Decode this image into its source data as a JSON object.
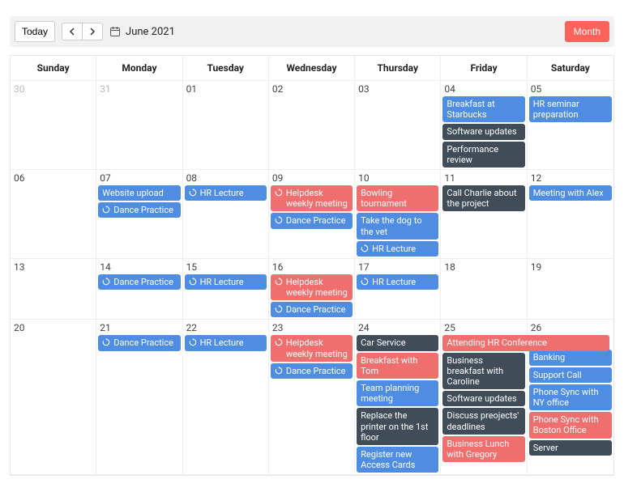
{
  "toolbar": {
    "today_label": "Today",
    "title": "June 2021",
    "view_label": "Month"
  },
  "daysOfWeek": [
    "Sunday",
    "Monday",
    "Tuesday",
    "Wednesday",
    "Thursday",
    "Friday",
    "Saturday"
  ],
  "weeks": [
    {
      "days": [
        {
          "date": "30",
          "out": true,
          "events": []
        },
        {
          "date": "31",
          "out": true,
          "events": []
        },
        {
          "date": "01",
          "events": []
        },
        {
          "date": "02",
          "events": []
        },
        {
          "date": "03",
          "events": []
        },
        {
          "date": "04",
          "events": [
            {
              "text": "Breakfast at Starbucks",
              "color": "blue"
            },
            {
              "text": "Software updates",
              "color": "dark"
            },
            {
              "text": "Performance review",
              "color": "dark"
            }
          ]
        },
        {
          "date": "05",
          "events": [
            {
              "text": "HR seminar preparation",
              "color": "blue"
            }
          ]
        }
      ]
    },
    {
      "days": [
        {
          "date": "06",
          "events": []
        },
        {
          "date": "07",
          "events": [
            {
              "text": "Website upload",
              "color": "blue"
            },
            {
              "text": "Dance Practice",
              "color": "blue",
              "recurring": true
            }
          ]
        },
        {
          "date": "08",
          "events": [
            {
              "text": "HR Lecture",
              "color": "blue",
              "recurring": true
            }
          ]
        },
        {
          "date": "09",
          "events": [
            {
              "text": "Helpdesk weekly meeting",
              "color": "red",
              "recurring": true
            },
            {
              "text": "Dance Practice",
              "color": "blue",
              "recurring": true
            }
          ]
        },
        {
          "date": "10",
          "events": [
            {
              "text": "Bowling tournament",
              "color": "red"
            },
            {
              "text": "Take the dog to the vet",
              "color": "blue"
            },
            {
              "text": "HR Lecture",
              "color": "blue",
              "recurring": true
            }
          ]
        },
        {
          "date": "11",
          "events": [
            {
              "text": "Call Charlie about the project",
              "color": "dark"
            }
          ]
        },
        {
          "date": "12",
          "events": [
            {
              "text": "Meeting with Alex",
              "color": "blue"
            }
          ]
        }
      ]
    },
    {
      "days": [
        {
          "date": "13",
          "events": []
        },
        {
          "date": "14",
          "events": [
            {
              "text": "Dance Practice",
              "color": "blue",
              "recurring": true
            }
          ]
        },
        {
          "date": "15",
          "events": [
            {
              "text": "HR Lecture",
              "color": "blue",
              "recurring": true
            }
          ]
        },
        {
          "date": "16",
          "events": [
            {
              "text": "Helpdesk weekly meeting",
              "color": "red",
              "recurring": true
            },
            {
              "text": "Dance Practice",
              "color": "blue",
              "recurring": true
            }
          ]
        },
        {
          "date": "17",
          "events": [
            {
              "text": "HR Lecture",
              "color": "blue",
              "recurring": true
            }
          ]
        },
        {
          "date": "18",
          "events": []
        },
        {
          "date": "19",
          "events": []
        }
      ]
    },
    {
      "days": [
        {
          "date": "20",
          "events": []
        },
        {
          "date": "21",
          "events": [
            {
              "text": "Dance Practice",
              "color": "blue",
              "recurring": true
            }
          ]
        },
        {
          "date": "22",
          "events": [
            {
              "text": "HR Lecture",
              "color": "blue",
              "recurring": true
            }
          ]
        },
        {
          "date": "23",
          "events": [
            {
              "text": "Helpdesk weekly meeting",
              "color": "red",
              "recurring": true
            },
            {
              "text": "Dance Practice",
              "color": "blue",
              "recurring": true
            }
          ]
        },
        {
          "date": "24",
          "events": [
            {
              "text": "Car Service",
              "color": "dark"
            },
            {
              "text": "Breakfast with Tom",
              "color": "red"
            },
            {
              "text": "Team planning meeting",
              "color": "blue"
            },
            {
              "text": "Replace the printer on the 1st floor",
              "color": "dark"
            },
            {
              "text": "Register new Access Cards",
              "color": "blue"
            }
          ]
        },
        {
          "date": "25",
          "events": [
            {
              "text": "Attending HR Conference",
              "color": "red",
              "span": 2
            },
            {
              "text": "Business breakfast with Caroline",
              "color": "dark"
            },
            {
              "text": "Software updates",
              "color": "dark"
            },
            {
              "text": "Discuss preojects' deadlines",
              "color": "dark"
            },
            {
              "text": "Business Lunch with Gregory",
              "color": "red"
            }
          ]
        },
        {
          "date": "26",
          "events": [
            {
              "pad": true
            },
            {
              "text": "Banking",
              "color": "blue"
            },
            {
              "text": "Support Call",
              "color": "blue"
            },
            {
              "text": "Phone Sync with NY office",
              "color": "blue"
            },
            {
              "text": "Phone Sync with Boston Office",
              "color": "red"
            },
            {
              "text": "Server",
              "color": "dark"
            }
          ]
        }
      ]
    }
  ]
}
